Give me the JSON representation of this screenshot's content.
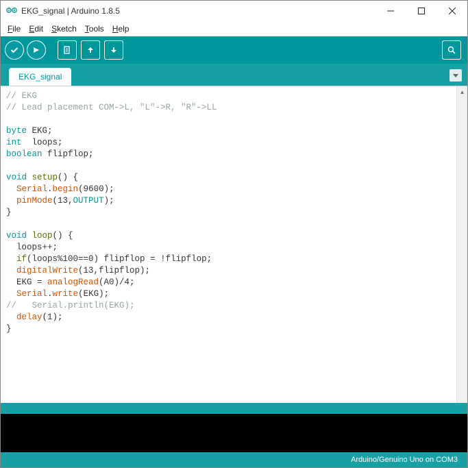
{
  "title": "EKG_signal | Arduino 1.8.5",
  "menus": {
    "file": "File",
    "edit": "Edit",
    "sketch": "Sketch",
    "tools": "Tools",
    "help": "Help"
  },
  "tab": {
    "name": "EKG_signal"
  },
  "code": {
    "l1_a": "// EKG",
    "l2_a": "// Lead placement COM->L, \"L\"->R, \"R\"->LL",
    "l4_a": "byte",
    "l4_b": " EKG;",
    "l5_a": "int",
    "l5_b": "  loops;",
    "l6_a": "boolean",
    "l6_b": " flipflop;",
    "l8_a": "void",
    "l8_b": " ",
    "l8_c": "setup",
    "l8_d": "() {",
    "l9_a": "  ",
    "l9_b": "Serial",
    "l9_c": ".",
    "l9_d": "begin",
    "l9_e": "(9600);",
    "l10_a": "  ",
    "l10_b": "pinMode",
    "l10_c": "(13,",
    "l10_d": "OUTPUT",
    "l10_e": ");",
    "l11_a": "}",
    "l13_a": "void",
    "l13_b": " ",
    "l13_c": "loop",
    "l13_d": "() {",
    "l14_a": "  loops++;",
    "l15_a": "  ",
    "l15_b": "if",
    "l15_c": "(loops%100==0) flipflop = !flipflop;",
    "l16_a": "  ",
    "l16_b": "digitalWrite",
    "l16_c": "(13,flipflop);",
    "l17_a": "  EKG = ",
    "l17_b": "analogRead",
    "l17_c": "(A0)/4;",
    "l18_a": "  ",
    "l18_b": "Serial",
    "l18_c": ".",
    "l18_d": "write",
    "l18_e": "(EKG);",
    "l19_a": "//   Serial.println(EKG);",
    "l20_a": "  ",
    "l20_b": "delay",
    "l20_c": "(1);",
    "l21_a": "}"
  },
  "footer": {
    "board": "Arduino/Genuino Uno on COM3"
  }
}
